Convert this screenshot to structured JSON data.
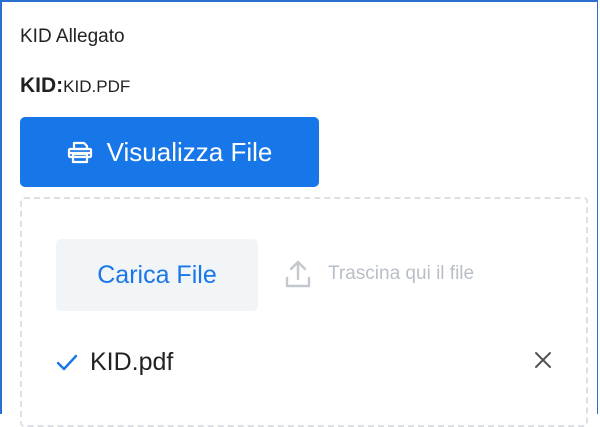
{
  "section": {
    "title": "KID Allegato"
  },
  "kid": {
    "key": "KID:",
    "file": "KID.PDF"
  },
  "view_button": {
    "label": "Visualizza File",
    "icon": "printer-icon",
    "color": "#1877e8"
  },
  "upload": {
    "button_label": "Carica File",
    "hint": "Trascina qui il file",
    "hint_icon": "upload-icon"
  },
  "uploaded_file": {
    "name": "KID.pdf",
    "status_icon": "check-icon",
    "remove_icon": "close-icon"
  }
}
